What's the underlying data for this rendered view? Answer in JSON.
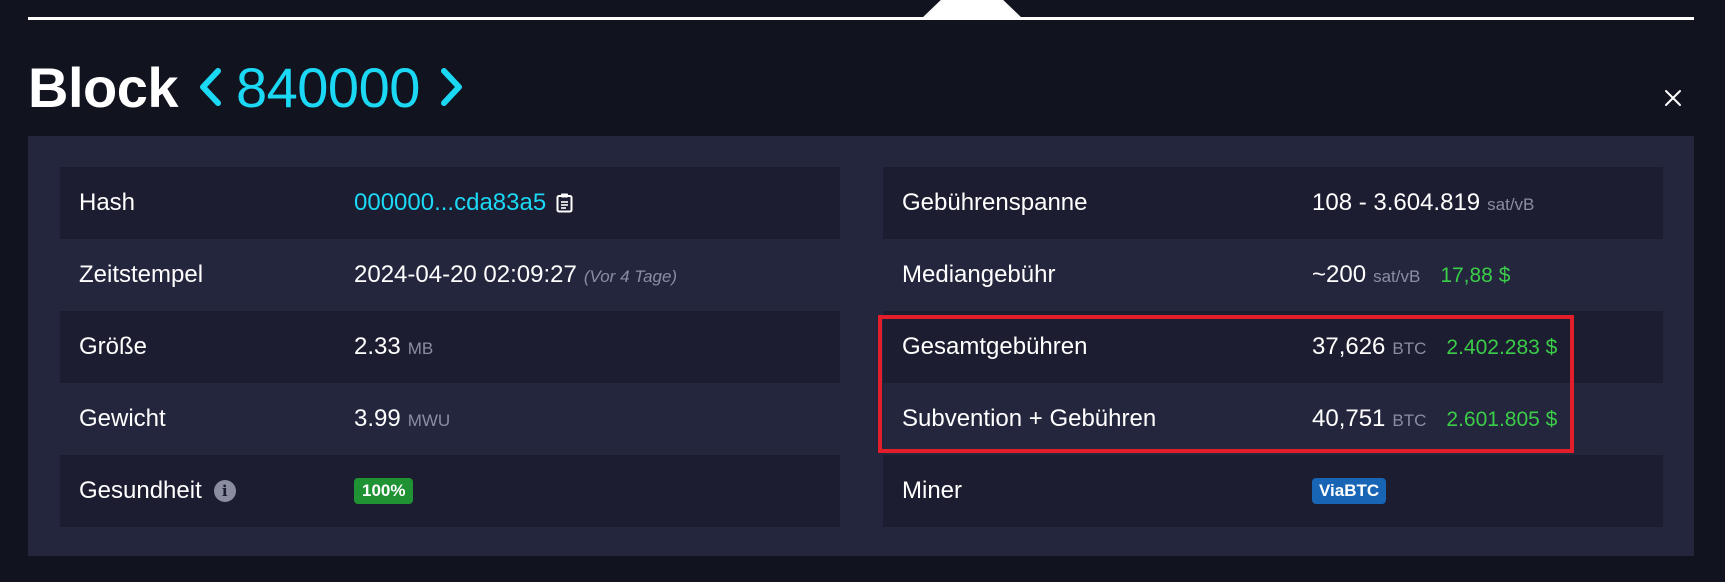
{
  "header": {
    "title_word": "Block",
    "block_number": "840000",
    "prev_icon": "chevron-left-icon",
    "next_icon": "chevron-right-icon",
    "close_icon": "close-icon"
  },
  "left_rows": [
    {
      "label": "Hash",
      "value": "000000...cda83a5",
      "icon": "copy-icon"
    },
    {
      "label": "Zeitstempel",
      "value": "2024-04-20 02:09:27",
      "note": "(Vor 4 Tage)"
    },
    {
      "label": "Größe",
      "value": "2.33",
      "unit": "MB"
    },
    {
      "label": "Gewicht",
      "value": "3.99",
      "unit": "MWU"
    },
    {
      "label": "Gesundheit",
      "info_icon": "info-icon",
      "badge": "100%"
    }
  ],
  "right_rows": [
    {
      "label": "Gebührenspanne",
      "value": "108 - 3.604.819",
      "unit": "sat/vB"
    },
    {
      "label": "Mediangebühr",
      "value": "~200",
      "unit": "sat/vB",
      "usd": "17,88 $"
    },
    {
      "label": "Gesamtgebühren",
      "value": "37,626",
      "unit": "BTC",
      "usd": "2.402.283 $"
    },
    {
      "label": "Subvention + Gebühren",
      "value": "40,751",
      "unit": "BTC",
      "usd": "2.601.805 $"
    },
    {
      "label": "Miner",
      "badge": "ViaBTC"
    }
  ],
  "colors": {
    "background": "#11131f",
    "panel": "#24263d",
    "row_dark": "#1c1d30",
    "accent": "#1bd8f4",
    "usd_green": "#3bcc49",
    "health_badge": "#1f9234",
    "miner_badge": "#1865b5",
    "highlight_border": "#e31e2b"
  }
}
